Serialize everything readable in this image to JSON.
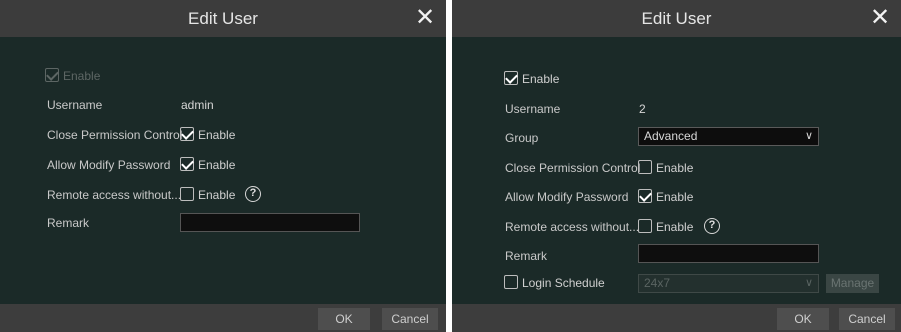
{
  "left": {
    "title": "Edit User",
    "close": "✕",
    "enable_label": "Enable",
    "username_label": "Username",
    "username_value": "admin",
    "close_perm_label": "Close Permission Control",
    "close_perm_cb": "Enable",
    "allow_modify_label": "Allow Modify Password",
    "allow_modify_cb": "Enable",
    "remote_label": "Remote access without...",
    "remote_cb": "Enable",
    "help": "?",
    "remark_label": "Remark",
    "ok": "OK",
    "cancel": "Cancel"
  },
  "right": {
    "title": "Edit User",
    "close": "✕",
    "enable_label": "Enable",
    "username_label": "Username",
    "username_value": "2",
    "group_label": "Group",
    "group_value": "Advanced",
    "close_perm_label": "Close Permission Control",
    "close_perm_cb": "Enable",
    "allow_modify_label": "Allow Modify Password",
    "allow_modify_cb": "Enable",
    "remote_label": "Remote access without...",
    "remote_cb": "Enable",
    "help": "?",
    "remark_label": "Remark",
    "login_schedule_label": "Login Schedule",
    "schedule_value": "24x7",
    "manage": "Manage",
    "ok": "OK",
    "cancel": "Cancel"
  }
}
